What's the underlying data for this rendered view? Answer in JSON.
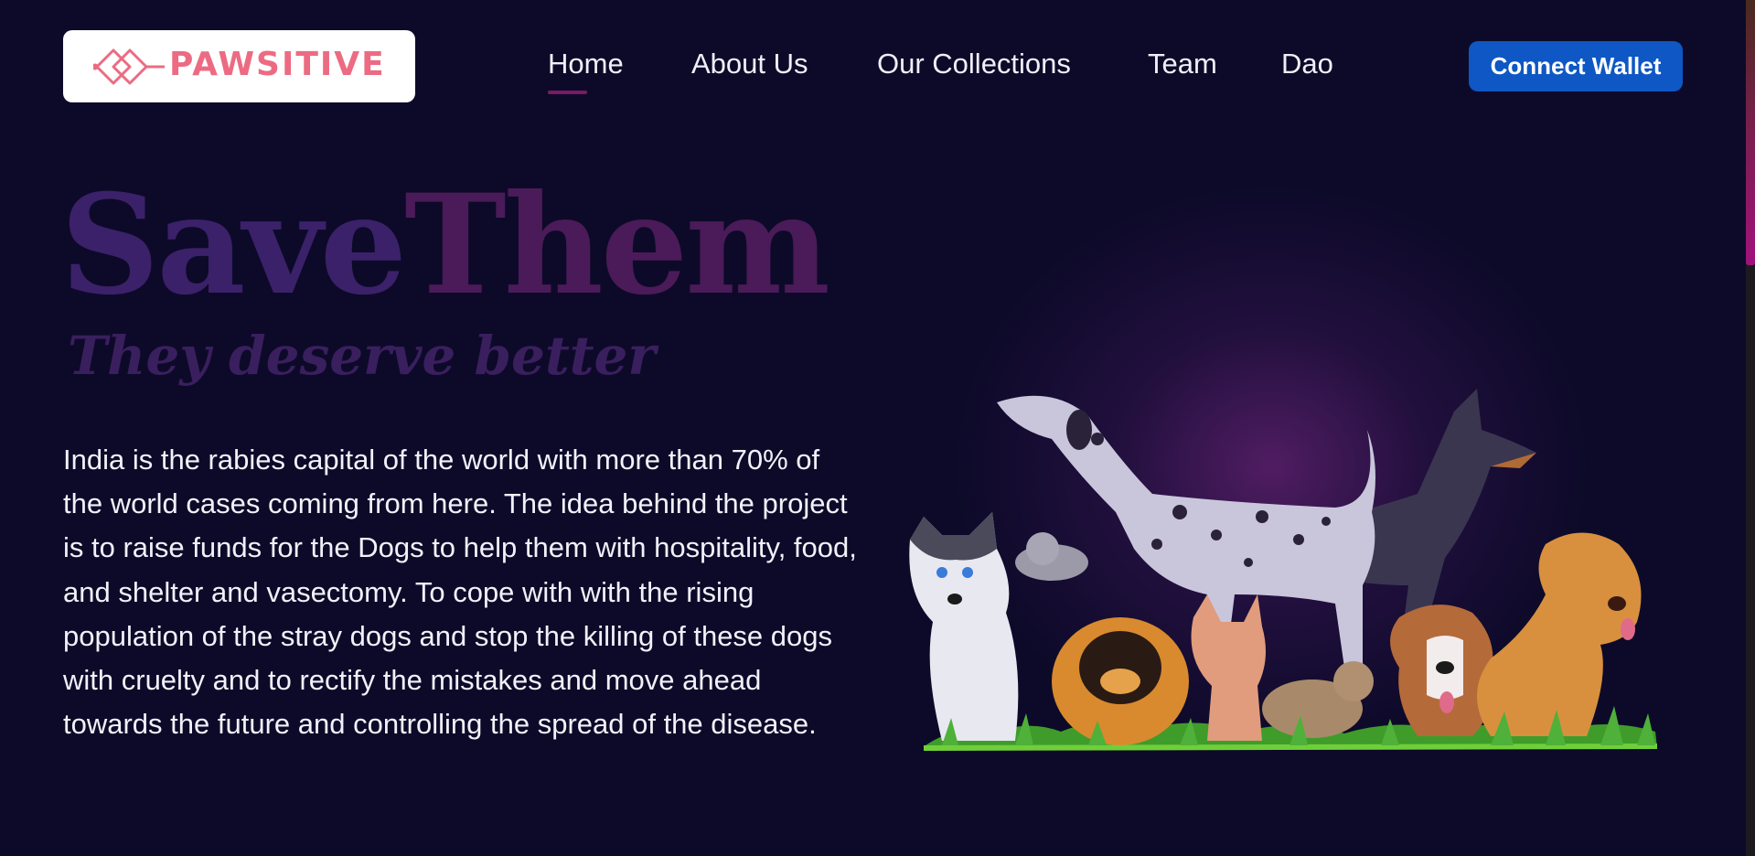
{
  "header": {
    "logo_text": "PAWSITIVE",
    "nav": [
      {
        "label": "Home",
        "active": true
      },
      {
        "label": "About Us",
        "active": false
      },
      {
        "label": "Our Collections",
        "active": false
      },
      {
        "label": "Team",
        "active": false
      },
      {
        "label": "Dao",
        "active": false
      }
    ],
    "connect_label": "Connect Wallet"
  },
  "hero": {
    "title_part1": "Save",
    "title_part2": "Them",
    "subtitle": "They deserve better",
    "body": "India is the rabies capital of the world with more than 70% of the world cases coming from here. The idea behind the project is to raise funds for the Dogs to help them with hospitality, food, and shelter and vasectomy. To cope with with the rising population of the stray dogs and stop the killing of these dogs with cruelty and to rectify the mistakes and move ahead towards the future and controlling the spread of the disease.",
    "illustration": "cartoon-dogs-and-cats-group"
  },
  "colors": {
    "background": "#0d0a29",
    "accent_button": "#0e57c4",
    "logo": "#ec6b82",
    "active_underline": "#7a1a66"
  },
  "icons": [
    "pawsitive-logo-icon"
  ]
}
